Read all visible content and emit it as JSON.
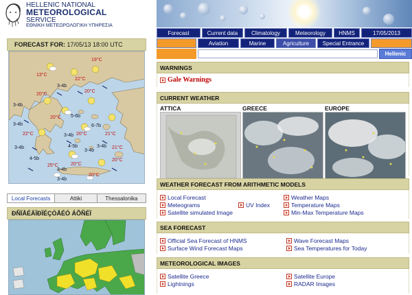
{
  "header": {
    "logo_line1": "HELLENIC NATIONAL",
    "logo_line2": "METEOROLOGICAL",
    "logo_line3": "SERVICE",
    "logo_line4": "ΕΘΝΙΚΗ ΜΕΤΕΩΡΟΛΟΓΙΚΗ ΥΠΗΡΕΣΙΑ"
  },
  "nav_primary": [
    "Forecast",
    "Current data",
    "Climatology",
    "Meteorology",
    "HNMS",
    "17/05/2013"
  ],
  "nav_secondary": [
    "Aviation",
    "Marine",
    "Agriculture",
    "Special Entrance"
  ],
  "search": {
    "value": "",
    "language_button": "Hellenic"
  },
  "forecast_panel": {
    "title": "FORECAST FOR:",
    "datetime": "17/05/13 18:00 UTC",
    "wind_labels": [
      "3-4b",
      "3-4b",
      "3-4b",
      "3-4b",
      "4-5b",
      "5-6b",
      "6-7b",
      "3-4b",
      "3-4b",
      "3-4b",
      "4-5b",
      "3-4b",
      "3-4b"
    ],
    "temp_labels": [
      "13°C",
      "19°C",
      "22°C",
      "20°C",
      "20°C",
      "20°C",
      "21°C",
      "21°C",
      "22°C",
      "20°C",
      "20°C",
      "20°C",
      "25°C",
      "20°C"
    ]
  },
  "location_tabs": [
    "Local Forecasts",
    "Attiki",
    "Thessalonika"
  ],
  "europe_panel": {
    "title": "ÐÑÏÅÉÄÏÐÏÉÇÓÅÉÓ ÁÕÑÉÏ"
  },
  "warnings": {
    "title": "WARNINGS",
    "link": "Gale Warnings"
  },
  "current_weather": {
    "title": "CURRENT WEATHER",
    "regions": [
      "ATTICA",
      "GREECE",
      "EUROPE"
    ]
  },
  "models": {
    "title": "WEATHER FORECAST FROM ARITHMETIC MODELS",
    "col1": [
      "Local Forecast",
      "Meteograms",
      "Satellite simulated Image"
    ],
    "col2": [
      "UV Index"
    ],
    "col3": [
      "Weather Maps",
      "Temperature Maps",
      "Min-Max Temperature Maps"
    ]
  },
  "sea": {
    "title": "SEA FORECAST",
    "col1": [
      "Official Sea Forecast of HNMS",
      "Surface Wind Forecast Maps"
    ],
    "col2": [
      "Wave Forecast Maps",
      "Sea Temperatures for Today"
    ]
  },
  "met_images": {
    "title": "METEOROLOGICAL IMAGES",
    "col1": [
      "Satellite Greece",
      "Lightnings"
    ],
    "col2": [
      "Satellite Europe",
      "RADAR Images"
    ]
  },
  "colors": {
    "nav_blue": "#14237a",
    "nav_orange": "#f39a2a",
    "section_khaki": "#d8d3a2",
    "warning_red": "#c00000",
    "link_blue": "#1a2a8e"
  }
}
